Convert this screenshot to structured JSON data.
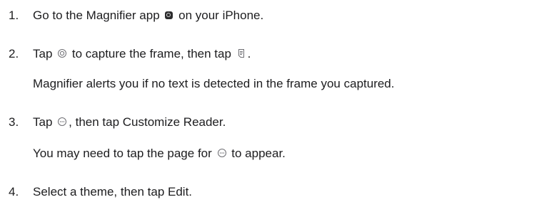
{
  "steps": [
    {
      "number": "1.",
      "before_icon": "Go to the Magnifier app",
      "icon": "magnifier-app-icon",
      "after_icon": "on your iPhone."
    },
    {
      "number": "2.",
      "part1": "Tap",
      "icon1": "shutter-icon",
      "part2": "to capture the frame, then tap",
      "icon2": "reader-icon",
      "part3": ".",
      "note": "Magnifier alerts you if no text is detected in the frame you captured."
    },
    {
      "number": "3.",
      "part1": "Tap",
      "icon1": "more-icon",
      "part2": ", then tap Customize Reader.",
      "note_before": "You may need to tap the page for",
      "note_icon": "more-icon",
      "note_after": "to appear."
    },
    {
      "number": "4.",
      "text": "Select a theme, then tap Edit."
    }
  ],
  "colors": {
    "text": "#1d1d1f",
    "icon": "#6e6e73"
  }
}
